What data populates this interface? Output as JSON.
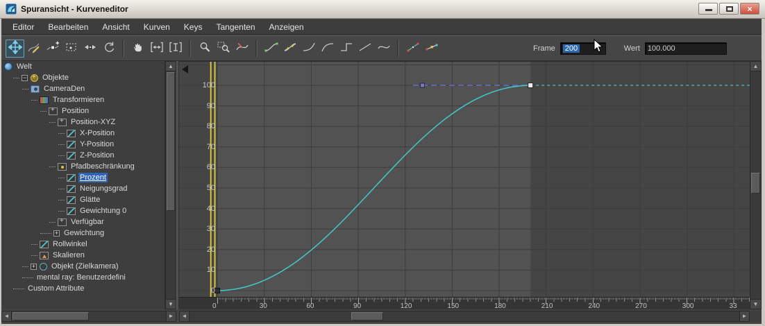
{
  "window": {
    "title": "Spuransicht - Kurveneditor"
  },
  "menu": {
    "items": [
      "Editor",
      "Bearbeiten",
      "Ansicht",
      "Kurven",
      "Keys",
      "Tangenten",
      "Anzeigen"
    ]
  },
  "toolbar": {
    "button_groups": [
      [
        "move-keys",
        "draw-curves",
        "add-keys",
        "region-keys",
        "slide-keys",
        "scale-keys"
      ],
      [
        "pan",
        "zoom-h-extents",
        "zoom-v-extents"
      ],
      [
        "zoom",
        "zoom-region",
        "isolate-curve"
      ],
      [
        "tangent-auto",
        "tangent-custom",
        "tangent-fast",
        "tangent-slow",
        "tangent-step",
        "tangent-linear",
        "tangent-smooth"
      ],
      [
        "show-tangents",
        "lock-tangents"
      ]
    ],
    "active_button": "move-keys",
    "frame_label": "Frame",
    "frame_value": "200",
    "wert_label": "Wert",
    "wert_value": "100.000"
  },
  "tree": {
    "items": [
      {
        "label": "Welt",
        "level": 0,
        "icon": "world"
      },
      {
        "label": "Objekte",
        "level": 1,
        "icon": "objects",
        "expander": "-"
      },
      {
        "label": "CameraDen",
        "level": 2,
        "icon": "camera"
      },
      {
        "label": "Transformieren",
        "level": 3,
        "icon": "transform"
      },
      {
        "label": "Position",
        "level": 4,
        "icon": "xyz"
      },
      {
        "label": "Position-XYZ",
        "level": 5,
        "icon": "xyz"
      },
      {
        "label": "X-Position",
        "level": 6,
        "icon": "curve"
      },
      {
        "label": "Y-Position",
        "level": 6,
        "icon": "curve"
      },
      {
        "label": "Z-Position",
        "level": 6,
        "icon": "curve"
      },
      {
        "label": "Pfadbeschränkung",
        "level": 5,
        "icon": "constraint"
      },
      {
        "label": "Prozent",
        "level": 6,
        "icon": "curve",
        "selected": true
      },
      {
        "label": "Neigungsgrad",
        "level": 6,
        "icon": "curve"
      },
      {
        "label": "Glätte",
        "level": 6,
        "icon": "curve"
      },
      {
        "label": "Gewichtung 0",
        "level": 6,
        "icon": "curve"
      },
      {
        "label": "Verfügbar",
        "level": 5,
        "icon": "xyz"
      },
      {
        "label": "Gewichtung",
        "level": 4,
        "icon": "none",
        "expander": "+"
      },
      {
        "label": "Rollwinkel",
        "level": 3,
        "icon": "curve"
      },
      {
        "label": "Skalieren",
        "level": 3,
        "icon": "scale"
      },
      {
        "label": "Objekt (Zielkamera)",
        "level": 2,
        "icon": "object",
        "expander": "+"
      },
      {
        "label": "mental ray: Benutzerdefini",
        "level": 2,
        "icon": "none"
      },
      {
        "label": "Custom Attribute",
        "level": 1,
        "icon": "none"
      }
    ]
  },
  "graph": {
    "type": "line",
    "x_range": [
      -24.4,
      340.0
    ],
    "y_range": [
      -3.4,
      111.5
    ],
    "x_grid_step": 30,
    "x_grid_max": 330,
    "y_grid_step": 10,
    "y_grid_max": 110,
    "x_tick_frames": [
      0,
      30,
      60,
      90,
      120,
      150,
      180,
      210,
      240,
      270,
      300,
      330
    ],
    "x_tick_labels": [
      "0",
      "30",
      "60",
      "90",
      "120",
      "150",
      "180",
      "210",
      "240",
      "270",
      "300",
      "33"
    ],
    "y_tick_values": [
      0,
      10,
      20,
      30,
      40,
      50,
      60,
      70,
      80,
      90,
      100
    ],
    "active_range": [
      0,
      200
    ],
    "time_cursor_frames": [
      -4.6,
      -2.0
    ],
    "curve": {
      "name": "Prozent",
      "keys": [
        {
          "frame": 0,
          "value": 0,
          "selected": false
        },
        {
          "frame": 200,
          "value": 100,
          "selected": true
        }
      ],
      "ease": 0.39,
      "extrapolation_value": 100
    },
    "ghost_segment": {
      "from_frame": 125,
      "to_frame": 200,
      "value": 100,
      "key_frame": 131
    },
    "colors": {
      "curve": "#45c3c3",
      "in_range_bg": "#525252",
      "out_range_bg": "#454545",
      "grid": "#3d3d3d",
      "time_cursor": "#d8c53e",
      "selected_key": "#f0f0f0",
      "key": "#2e2e2e",
      "ghost_line": "#5e66a8",
      "ghost_key": "#7b74c8"
    }
  }
}
